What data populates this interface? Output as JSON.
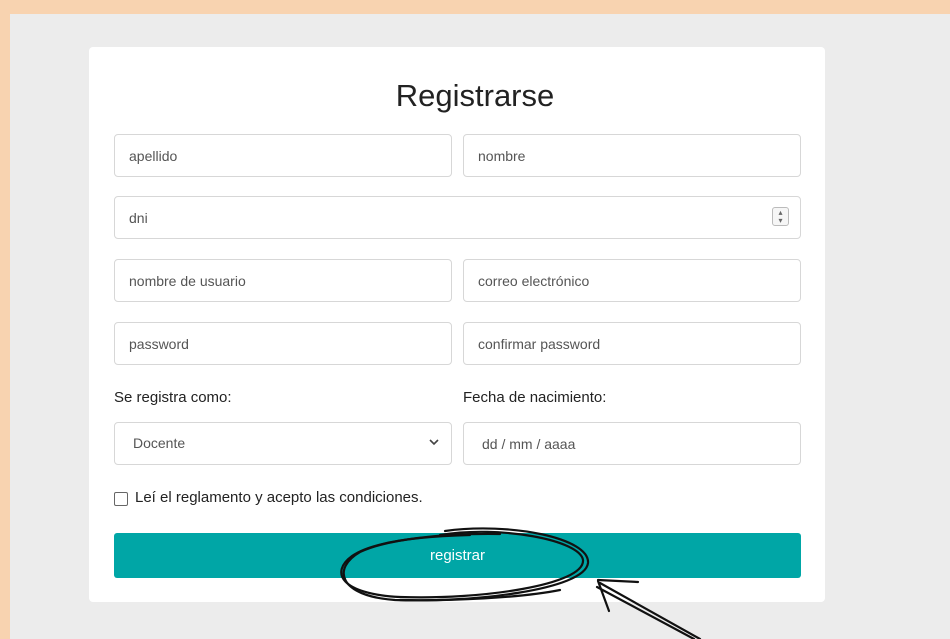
{
  "form": {
    "title": "Registrarse",
    "apellido_placeholder": "apellido",
    "nombre_placeholder": "nombre",
    "dni_placeholder": "dni",
    "usuario_placeholder": "nombre de usuario",
    "correo_placeholder": "correo electrónico",
    "password_placeholder": "password",
    "confirm_placeholder": "confirmar password",
    "role_label": "Se registra como:",
    "role_selected": "Docente",
    "birth_label": "Fecha de nacimiento:",
    "birth_placeholder": "dd / mm / aaaa",
    "terms_label": "Leí el reglamento y acepto las condiciones.",
    "terms_checked": false,
    "submit_label": "registrar"
  },
  "colors": {
    "page_background": "#f8d3b0",
    "panel_background": "#ececec",
    "button": "#00a6a6",
    "annotation": "#111111"
  },
  "icons": {
    "stepper": "number-stepper-icon",
    "select": "chevron-down-icon",
    "annotation_circle": "hand-drawn-circle",
    "annotation_arrow": "hand-drawn-arrow"
  }
}
